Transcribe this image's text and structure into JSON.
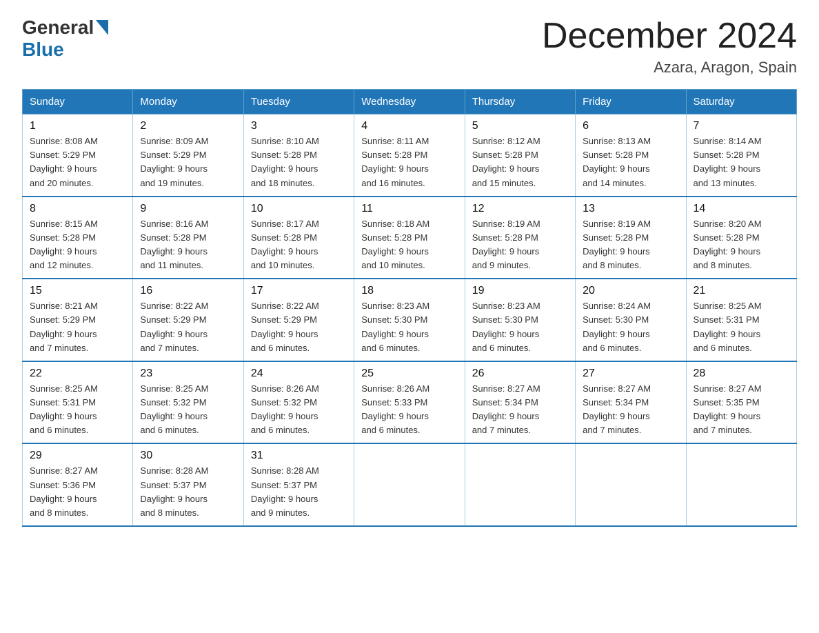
{
  "logo": {
    "general": "General",
    "blue": "Blue"
  },
  "title": "December 2024",
  "location": "Azara, Aragon, Spain",
  "days_of_week": [
    "Sunday",
    "Monday",
    "Tuesday",
    "Wednesday",
    "Thursday",
    "Friday",
    "Saturday"
  ],
  "weeks": [
    [
      {
        "day": "1",
        "sunrise": "8:08 AM",
        "sunset": "5:29 PM",
        "daylight": "9 hours and 20 minutes."
      },
      {
        "day": "2",
        "sunrise": "8:09 AM",
        "sunset": "5:29 PM",
        "daylight": "9 hours and 19 minutes."
      },
      {
        "day": "3",
        "sunrise": "8:10 AM",
        "sunset": "5:28 PM",
        "daylight": "9 hours and 18 minutes."
      },
      {
        "day": "4",
        "sunrise": "8:11 AM",
        "sunset": "5:28 PM",
        "daylight": "9 hours and 16 minutes."
      },
      {
        "day": "5",
        "sunrise": "8:12 AM",
        "sunset": "5:28 PM",
        "daylight": "9 hours and 15 minutes."
      },
      {
        "day": "6",
        "sunrise": "8:13 AM",
        "sunset": "5:28 PM",
        "daylight": "9 hours and 14 minutes."
      },
      {
        "day": "7",
        "sunrise": "8:14 AM",
        "sunset": "5:28 PM",
        "daylight": "9 hours and 13 minutes."
      }
    ],
    [
      {
        "day": "8",
        "sunrise": "8:15 AM",
        "sunset": "5:28 PM",
        "daylight": "9 hours and 12 minutes."
      },
      {
        "day": "9",
        "sunrise": "8:16 AM",
        "sunset": "5:28 PM",
        "daylight": "9 hours and 11 minutes."
      },
      {
        "day": "10",
        "sunrise": "8:17 AM",
        "sunset": "5:28 PM",
        "daylight": "9 hours and 10 minutes."
      },
      {
        "day": "11",
        "sunrise": "8:18 AM",
        "sunset": "5:28 PM",
        "daylight": "9 hours and 10 minutes."
      },
      {
        "day": "12",
        "sunrise": "8:19 AM",
        "sunset": "5:28 PM",
        "daylight": "9 hours and 9 minutes."
      },
      {
        "day": "13",
        "sunrise": "8:19 AM",
        "sunset": "5:28 PM",
        "daylight": "9 hours and 8 minutes."
      },
      {
        "day": "14",
        "sunrise": "8:20 AM",
        "sunset": "5:28 PM",
        "daylight": "9 hours and 8 minutes."
      }
    ],
    [
      {
        "day": "15",
        "sunrise": "8:21 AM",
        "sunset": "5:29 PM",
        "daylight": "9 hours and 7 minutes."
      },
      {
        "day": "16",
        "sunrise": "8:22 AM",
        "sunset": "5:29 PM",
        "daylight": "9 hours and 7 minutes."
      },
      {
        "day": "17",
        "sunrise": "8:22 AM",
        "sunset": "5:29 PM",
        "daylight": "9 hours and 6 minutes."
      },
      {
        "day": "18",
        "sunrise": "8:23 AM",
        "sunset": "5:30 PM",
        "daylight": "9 hours and 6 minutes."
      },
      {
        "day": "19",
        "sunrise": "8:23 AM",
        "sunset": "5:30 PM",
        "daylight": "9 hours and 6 minutes."
      },
      {
        "day": "20",
        "sunrise": "8:24 AM",
        "sunset": "5:30 PM",
        "daylight": "9 hours and 6 minutes."
      },
      {
        "day": "21",
        "sunrise": "8:25 AM",
        "sunset": "5:31 PM",
        "daylight": "9 hours and 6 minutes."
      }
    ],
    [
      {
        "day": "22",
        "sunrise": "8:25 AM",
        "sunset": "5:31 PM",
        "daylight": "9 hours and 6 minutes."
      },
      {
        "day": "23",
        "sunrise": "8:25 AM",
        "sunset": "5:32 PM",
        "daylight": "9 hours and 6 minutes."
      },
      {
        "day": "24",
        "sunrise": "8:26 AM",
        "sunset": "5:32 PM",
        "daylight": "9 hours and 6 minutes."
      },
      {
        "day": "25",
        "sunrise": "8:26 AM",
        "sunset": "5:33 PM",
        "daylight": "9 hours and 6 minutes."
      },
      {
        "day": "26",
        "sunrise": "8:27 AM",
        "sunset": "5:34 PM",
        "daylight": "9 hours and 7 minutes."
      },
      {
        "day": "27",
        "sunrise": "8:27 AM",
        "sunset": "5:34 PM",
        "daylight": "9 hours and 7 minutes."
      },
      {
        "day": "28",
        "sunrise": "8:27 AM",
        "sunset": "5:35 PM",
        "daylight": "9 hours and 7 minutes."
      }
    ],
    [
      {
        "day": "29",
        "sunrise": "8:27 AM",
        "sunset": "5:36 PM",
        "daylight": "9 hours and 8 minutes."
      },
      {
        "day": "30",
        "sunrise": "8:28 AM",
        "sunset": "5:37 PM",
        "daylight": "9 hours and 8 minutes."
      },
      {
        "day": "31",
        "sunrise": "8:28 AM",
        "sunset": "5:37 PM",
        "daylight": "9 hours and 9 minutes."
      },
      null,
      null,
      null,
      null
    ]
  ],
  "labels": {
    "sunrise": "Sunrise:",
    "sunset": "Sunset:",
    "daylight": "Daylight:"
  }
}
